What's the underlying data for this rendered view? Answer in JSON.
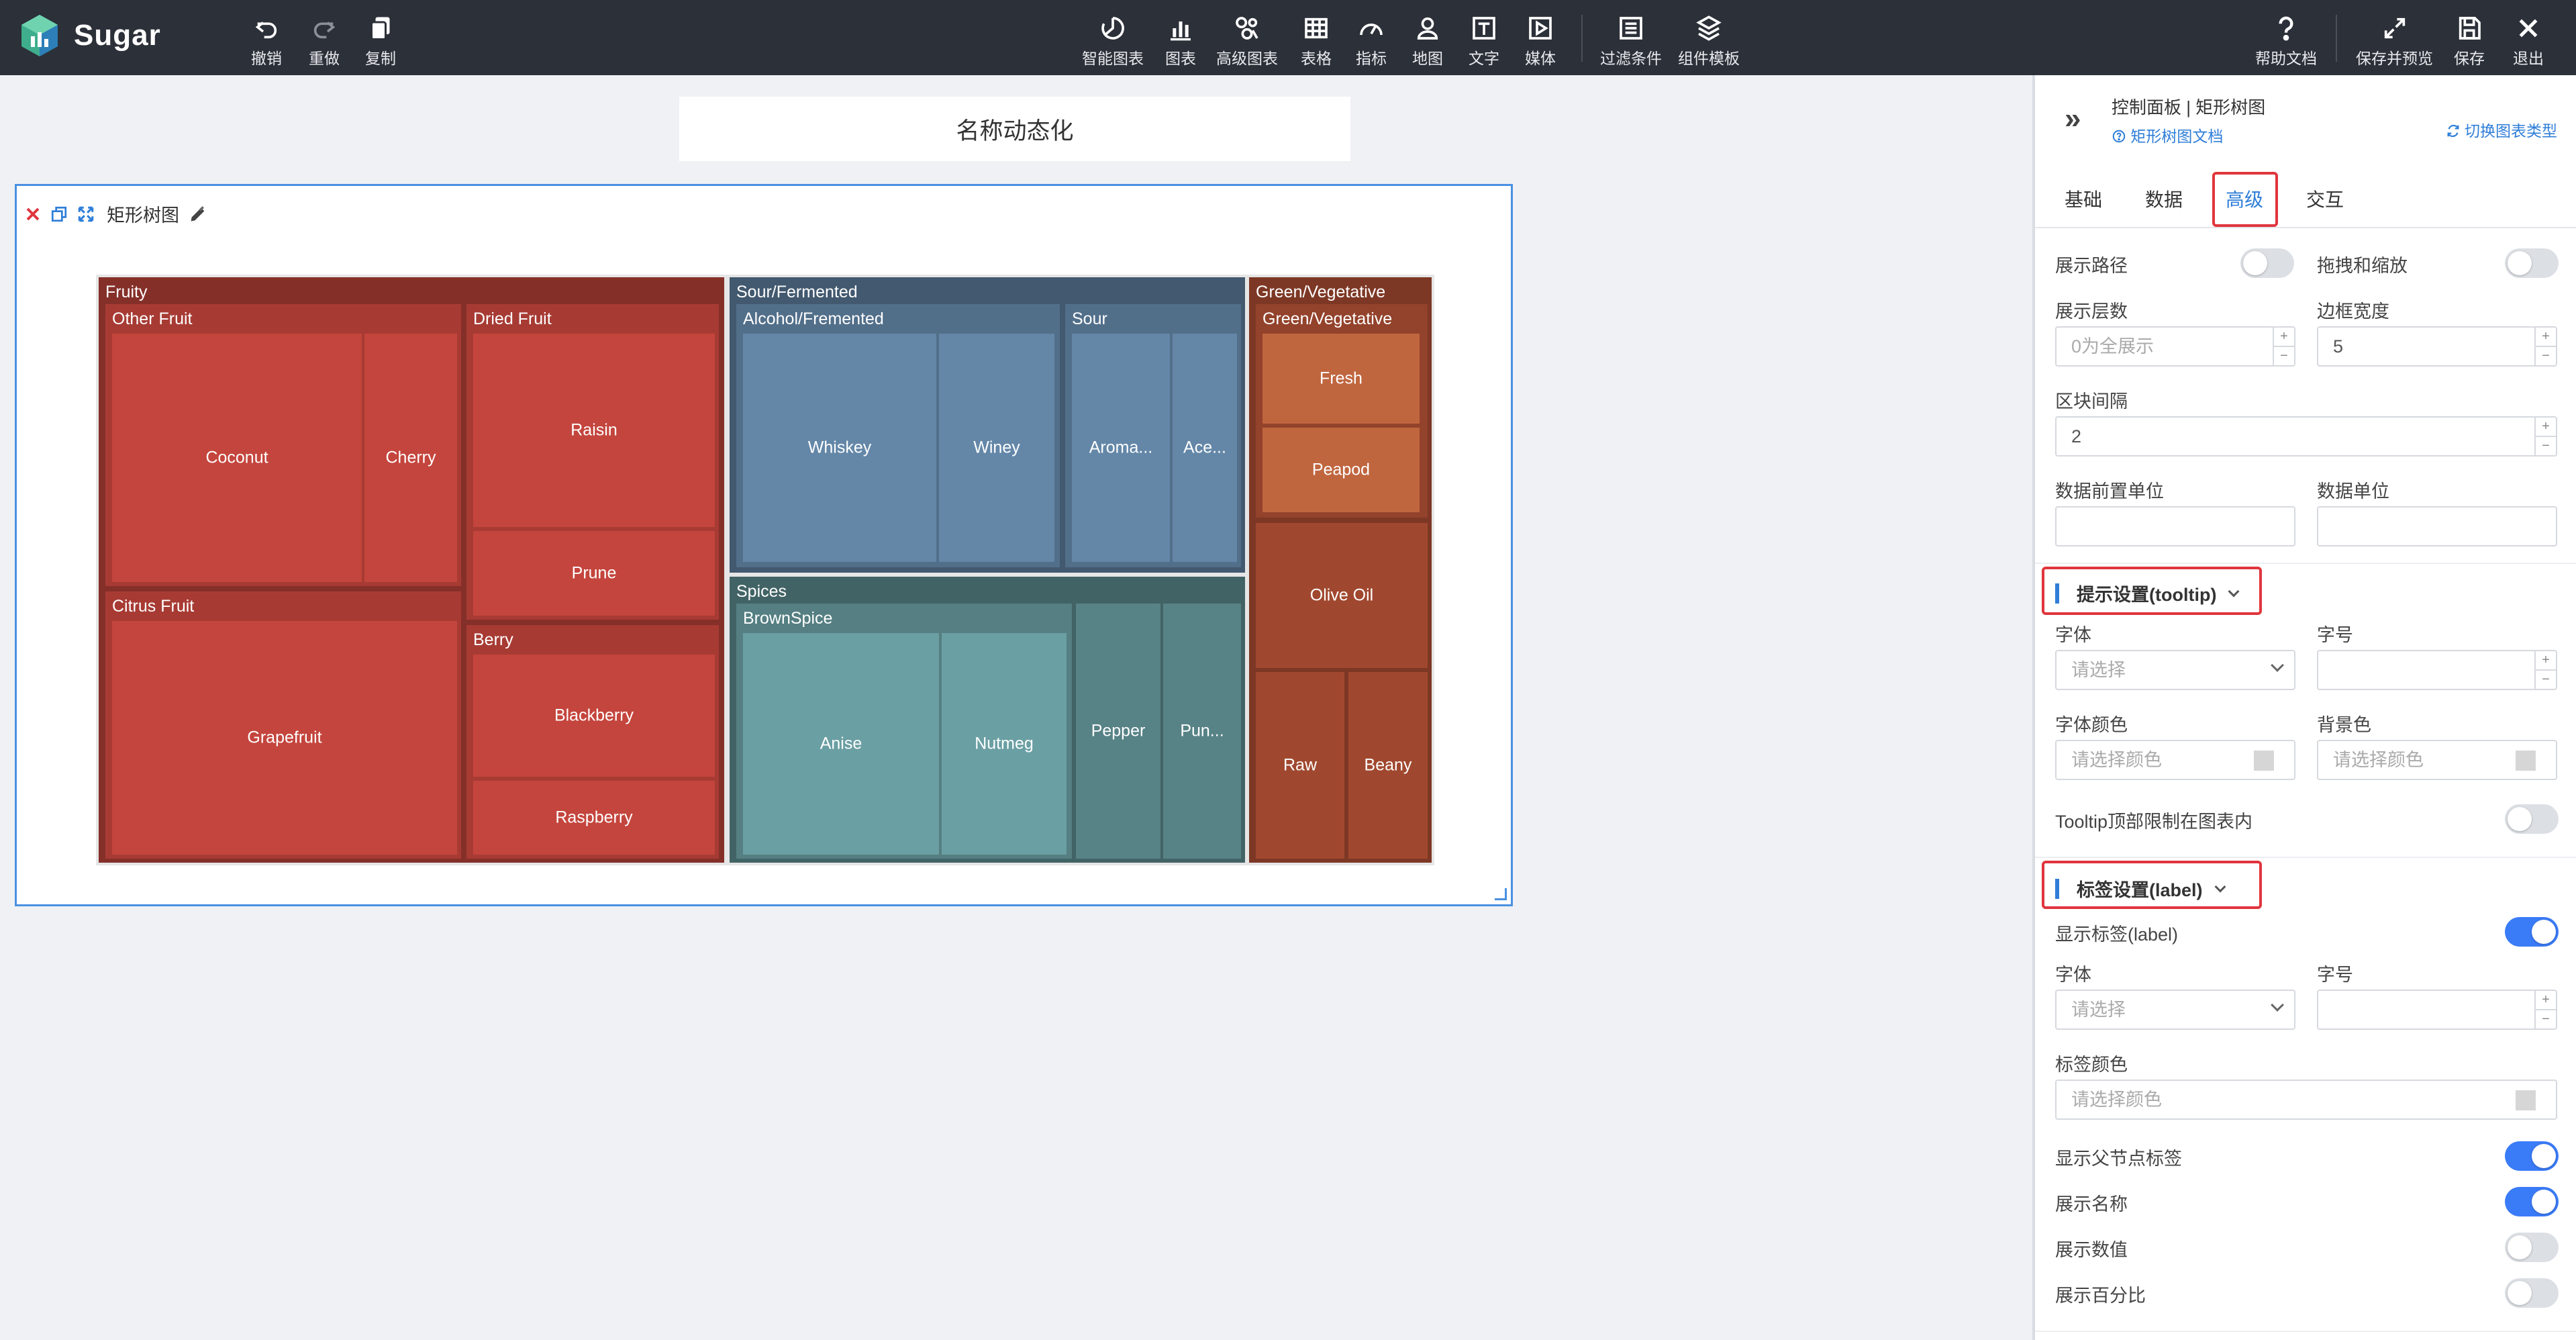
{
  "app": {
    "name": "Sugar"
  },
  "toolbar": {
    "left": [
      {
        "label": "撤销",
        "icon": "undo-icon"
      },
      {
        "label": "重做",
        "icon": "redo-icon"
      },
      {
        "label": "复制",
        "icon": "copy-icon"
      }
    ],
    "center": [
      {
        "label": "智能图表",
        "icon": "smart-chart-icon"
      },
      {
        "label": "图表",
        "icon": "bar-chart-icon"
      },
      {
        "label": "高级图表",
        "icon": "advanced-chart-icon"
      },
      {
        "label": "表格",
        "icon": "table-icon"
      },
      {
        "label": "指标",
        "icon": "gauge-icon"
      },
      {
        "label": "地图",
        "icon": "map-pin-icon"
      },
      {
        "label": "文字",
        "icon": "text-icon"
      },
      {
        "label": "媒体",
        "icon": "media-icon"
      },
      {
        "label": "过滤条件",
        "icon": "filter-icon"
      },
      {
        "label": "组件模板",
        "icon": "template-icon"
      }
    ],
    "right": [
      {
        "label": "帮助文档",
        "icon": "help-icon"
      },
      {
        "label": "保存并预览",
        "icon": "expand-icon"
      },
      {
        "label": "保存",
        "icon": "save-icon"
      },
      {
        "label": "退出",
        "icon": "close-icon"
      }
    ]
  },
  "canvas": {
    "title": "名称动态化",
    "chart_card": {
      "name": "矩形树图"
    }
  },
  "chart_data": {
    "type": "treemap",
    "title": "",
    "colors": {
      "Fruity": "#c4453d",
      "Sour/Fermented": "#6487a8",
      "Spices": "#6a9fa3",
      "Green/Vegetative": "#a0482f",
      "Fresh": "#c0663f"
    },
    "nodes": [
      {
        "label": "Fruity",
        "children": [
          {
            "label": "Other Fruit",
            "children": [
              {
                "label": "Coconut"
              },
              {
                "label": "Cherry"
              }
            ]
          },
          {
            "label": "Dried Fruit",
            "children": [
              {
                "label": "Raisin"
              },
              {
                "label": "Prune"
              }
            ]
          },
          {
            "label": "Citrus Fruit",
            "children": [
              {
                "label": "Grapefruit"
              }
            ]
          },
          {
            "label": "Berry",
            "children": [
              {
                "label": "Blackberry"
              },
              {
                "label": "Raspberry"
              }
            ]
          }
        ]
      },
      {
        "label": "Sour/Fermented",
        "children": [
          {
            "label": "Alcohol/Fremented",
            "children": [
              {
                "label": "Whiskey"
              },
              {
                "label": "Winey"
              }
            ]
          },
          {
            "label": "Sour",
            "children": [
              {
                "label": "Aroma..."
              },
              {
                "label": "Ace..."
              }
            ]
          }
        ]
      },
      {
        "label": "Spices",
        "children": [
          {
            "label": "BrownSpice",
            "children": [
              {
                "label": "Anise"
              },
              {
                "label": "Nutmeg"
              }
            ]
          },
          {
            "label": "Pepper"
          },
          {
            "label": "Pun..."
          }
        ]
      },
      {
        "label": "Green/Vegetative",
        "children": [
          {
            "label": "Green/Vegetative",
            "children": [
              {
                "label": "Fresh"
              },
              {
                "label": "Peapod"
              }
            ]
          },
          {
            "label": "Olive Oil"
          },
          {
            "label": "Raw"
          },
          {
            "label": "Beany"
          }
        ]
      }
    ]
  },
  "panel": {
    "breadcrumb": "控制面板 | 矩形树图",
    "doc_link": "矩形树图文档",
    "switch_type": "切换图表类型",
    "tabs": [
      {
        "label": "基础",
        "active": false
      },
      {
        "label": "数据",
        "active": false
      },
      {
        "label": "高级",
        "active": true
      },
      {
        "label": "交互",
        "active": false
      }
    ],
    "show_path": {
      "label": "展示路径",
      "on": false
    },
    "drag_zoom": {
      "label": "拖拽和缩放",
      "on": false
    },
    "levels": {
      "label": "展示层数",
      "placeholder": "0为全展示",
      "value": ""
    },
    "border_width": {
      "label": "边框宽度",
      "value": "5"
    },
    "block_gap": {
      "label": "区块间隔",
      "value": "2"
    },
    "data_prefix_unit": {
      "label": "数据前置单位",
      "value": ""
    },
    "data_unit": {
      "label": "数据单位",
      "value": ""
    },
    "tooltip": {
      "title": "提示设置(tooltip)",
      "font": {
        "label": "字体",
        "placeholder": "请选择"
      },
      "font_size": {
        "label": "字号",
        "value": ""
      },
      "font_color": {
        "label": "字体颜色",
        "placeholder": "请选择颜色"
      },
      "bg_color": {
        "label": "背景色",
        "placeholder": "请选择颜色"
      },
      "confine": {
        "label": "Tooltip顶部限制在图表内",
        "on": false
      }
    },
    "label": {
      "title": "标签设置(label)",
      "show_label": {
        "label": "显示标签(label)",
        "on": true
      },
      "font": {
        "label": "字体",
        "placeholder": "请选择"
      },
      "font_size": {
        "label": "字号",
        "value": ""
      },
      "label_color": {
        "label": "标签颜色",
        "placeholder": "请选择颜色"
      },
      "show_parent_label": {
        "label": "显示父节点标签",
        "on": true
      },
      "show_name": {
        "label": "展示名称",
        "on": true
      },
      "show_value": {
        "label": "展示数值",
        "on": false
      },
      "show_percent": {
        "label": "展示百分比",
        "on": false
      }
    }
  }
}
